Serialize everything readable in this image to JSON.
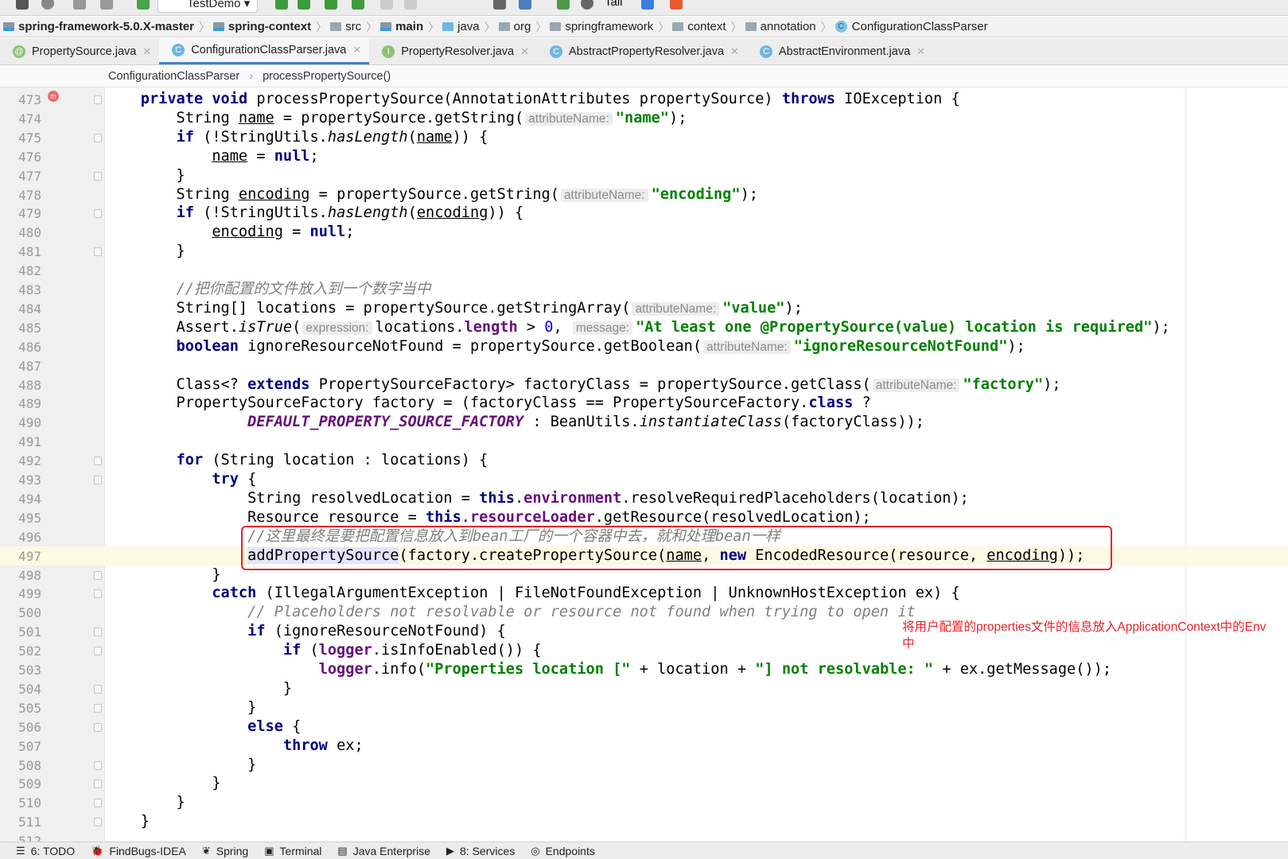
{
  "toolbar": {
    "run_config": "TestDemo",
    "tail_label": "Tail"
  },
  "navbar": {
    "items": [
      {
        "label": "spring-framework-5.0.X-master",
        "bold": true,
        "icon": "module-folder-icon"
      },
      {
        "label": "spring-context",
        "bold": true,
        "icon": "module-folder-icon"
      },
      {
        "label": "src",
        "bold": false,
        "icon": "folder-icon"
      },
      {
        "label": "main",
        "bold": true,
        "icon": "module-folder-icon"
      },
      {
        "label": "java",
        "bold": false,
        "icon": "source-folder-icon"
      },
      {
        "label": "org",
        "bold": false,
        "icon": "folder-icon"
      },
      {
        "label": "springframework",
        "bold": false,
        "icon": "folder-icon"
      },
      {
        "label": "context",
        "bold": false,
        "icon": "folder-icon"
      },
      {
        "label": "annotation",
        "bold": false,
        "icon": "folder-icon"
      },
      {
        "label": "ConfigurationClassParser",
        "bold": false,
        "icon": "class-icon"
      }
    ]
  },
  "tabs": [
    {
      "label": "PropertySource.java",
      "badge": "@",
      "color": "#8dc26f",
      "active": false
    },
    {
      "label": "ConfigurationClassParser.java",
      "badge": "C",
      "color": "#6fb6e0",
      "active": true
    },
    {
      "label": "PropertyResolver.java",
      "badge": "I",
      "color": "#8dc26f",
      "active": false
    },
    {
      "label": "AbstractPropertyResolver.java",
      "badge": "C",
      "color": "#6fb6e0",
      "active": false
    },
    {
      "label": "AbstractEnvironment.java",
      "badge": "C",
      "color": "#6fb6e0",
      "active": false
    }
  ],
  "editor_breadcrumb": {
    "class": "ConfigurationClassParser",
    "method": "processPropertySource()"
  },
  "editor": {
    "current_line": 497,
    "lines": [
      {
        "n": "473",
        "t": [
          {
            "t": "    "
          },
          {
            "t": "private",
            "c": "kw"
          },
          {
            "t": " "
          },
          {
            "t": "void",
            "c": "kw"
          },
          {
            "t": " processPropertySource(AnnotationAttributes propertySource) "
          },
          {
            "t": "throws",
            "c": "kw"
          },
          {
            "t": " IOException {"
          }
        ]
      },
      {
        "n": "474",
        "t": [
          {
            "t": "        String "
          },
          {
            "t": "name",
            "c": "ul"
          },
          {
            "t": " = propertySource.getString("
          },
          {
            "t": "attributeName:",
            "c": "hint"
          },
          {
            "t": "\"name\"",
            "c": "str"
          },
          {
            "t": ");"
          }
        ]
      },
      {
        "n": "475",
        "t": [
          {
            "t": "        "
          },
          {
            "t": "if",
            "c": "kw"
          },
          {
            "t": " (!StringUtils."
          },
          {
            "t": "hasLength",
            "c": "it"
          },
          {
            "t": "("
          },
          {
            "t": "name",
            "c": "ul"
          },
          {
            "t": ")) {"
          }
        ]
      },
      {
        "n": "476",
        "t": [
          {
            "t": "            "
          },
          {
            "t": "name",
            "c": "ul"
          },
          {
            "t": " = "
          },
          {
            "t": "null",
            "c": "kw"
          },
          {
            "t": ";"
          }
        ]
      },
      {
        "n": "477",
        "t": [
          {
            "t": "        }"
          }
        ]
      },
      {
        "n": "478",
        "t": [
          {
            "t": "        String "
          },
          {
            "t": "encoding",
            "c": "ul"
          },
          {
            "t": " = propertySource.getString("
          },
          {
            "t": "attributeName:",
            "c": "hint"
          },
          {
            "t": "\"encoding\"",
            "c": "str"
          },
          {
            "t": ");"
          }
        ]
      },
      {
        "n": "479",
        "t": [
          {
            "t": "        "
          },
          {
            "t": "if",
            "c": "kw"
          },
          {
            "t": " (!StringUtils."
          },
          {
            "t": "hasLength",
            "c": "it"
          },
          {
            "t": "("
          },
          {
            "t": "encoding",
            "c": "ul"
          },
          {
            "t": ")) {"
          }
        ]
      },
      {
        "n": "480",
        "t": [
          {
            "t": "            "
          },
          {
            "t": "encoding",
            "c": "ul"
          },
          {
            "t": " = "
          },
          {
            "t": "null",
            "c": "kw"
          },
          {
            "t": ";"
          }
        ]
      },
      {
        "n": "481",
        "t": [
          {
            "t": "        }"
          }
        ]
      },
      {
        "n": "482",
        "t": []
      },
      {
        "n": "483",
        "t": [
          {
            "t": "        "
          },
          {
            "t": "//把你配置的文件放入到一个数字当中",
            "c": "cm"
          }
        ]
      },
      {
        "n": "484",
        "t": [
          {
            "t": "        String[] locations = propertySource.getStringArray("
          },
          {
            "t": "attributeName:",
            "c": "hint"
          },
          {
            "t": "\"value\"",
            "c": "str"
          },
          {
            "t": ");"
          }
        ]
      },
      {
        "n": "485",
        "t": [
          {
            "t": "        Assert."
          },
          {
            "t": "isTrue",
            "c": "it"
          },
          {
            "t": "("
          },
          {
            "t": "expression:",
            "c": "hint"
          },
          {
            "t": "locations."
          },
          {
            "t": "length",
            "c": "field"
          },
          {
            "t": " > "
          },
          {
            "t": "0",
            "c": "num"
          },
          {
            "t": ", "
          },
          {
            "t": "message:",
            "c": "hint"
          },
          {
            "t": "\"At least one @PropertySource(value) location is required\"",
            "c": "str"
          },
          {
            "t": ");"
          }
        ]
      },
      {
        "n": "486",
        "t": [
          {
            "t": "        "
          },
          {
            "t": "boolean",
            "c": "kw"
          },
          {
            "t": " ignoreResourceNotFound = propertySource.getBoolean("
          },
          {
            "t": "attributeName:",
            "c": "hint"
          },
          {
            "t": "\"ignoreResourceNotFound\"",
            "c": "str"
          },
          {
            "t": ");"
          }
        ]
      },
      {
        "n": "487",
        "t": []
      },
      {
        "n": "488",
        "t": [
          {
            "t": "        Class<? "
          },
          {
            "t": "extends",
            "c": "kw"
          },
          {
            "t": " PropertySourceFactory> factoryClass = propertySource.getClass("
          },
          {
            "t": "attributeName:",
            "c": "hint"
          },
          {
            "t": "\"factory\"",
            "c": "str"
          },
          {
            "t": ");"
          }
        ]
      },
      {
        "n": "489",
        "t": [
          {
            "t": "        PropertySourceFactory factory = (factoryClass == PropertySourceFactory."
          },
          {
            "t": "class",
            "c": "kw"
          },
          {
            "t": " ?"
          }
        ]
      },
      {
        "n": "490",
        "t": [
          {
            "t": "                "
          },
          {
            "t": "DEFAULT_PROPERTY_SOURCE_FACTORY",
            "c": "const"
          },
          {
            "t": " : BeanUtils."
          },
          {
            "t": "instantiateClass",
            "c": "it"
          },
          {
            "t": "(factoryClass));"
          }
        ]
      },
      {
        "n": "491",
        "t": []
      },
      {
        "n": "492",
        "t": [
          {
            "t": "        "
          },
          {
            "t": "for",
            "c": "kw"
          },
          {
            "t": " (String location : locations) {"
          }
        ]
      },
      {
        "n": "493",
        "t": [
          {
            "t": "            "
          },
          {
            "t": "try",
            "c": "kw"
          },
          {
            "t": " {"
          }
        ]
      },
      {
        "n": "494",
        "t": [
          {
            "t": "                String resolvedLocation = "
          },
          {
            "t": "this",
            "c": "kw"
          },
          {
            "t": "."
          },
          {
            "t": "environment",
            "c": "field"
          },
          {
            "t": ".resolveRequiredPlaceholders(location);"
          }
        ]
      },
      {
        "n": "495",
        "t": [
          {
            "t": "                Resource resource = "
          },
          {
            "t": "this",
            "c": "kw"
          },
          {
            "t": "."
          },
          {
            "t": "resourceLoader",
            "c": "field"
          },
          {
            "t": ".getResource(resolvedLocation);"
          }
        ]
      },
      {
        "n": "496",
        "t": [
          {
            "t": "                "
          },
          {
            "t": "//这里最终是要把配置信息放入到bean工厂的一个容器中去，就和处理bean一样",
            "c": "cm"
          }
        ]
      },
      {
        "n": "497",
        "t": [
          {
            "t": "                "
          },
          {
            "t": "addPropertySource",
            "c": "caret"
          },
          {
            "t": "(factory.createPropertySource("
          },
          {
            "t": "name",
            "c": "ul"
          },
          {
            "t": ", "
          },
          {
            "t": "new",
            "c": "kw"
          },
          {
            "t": " EncodedResource(resource, "
          },
          {
            "t": "encoding",
            "c": "ul"
          },
          {
            "t": "));"
          }
        ]
      },
      {
        "n": "498",
        "t": [
          {
            "t": "            }"
          }
        ]
      },
      {
        "n": "499",
        "t": [
          {
            "t": "            "
          },
          {
            "t": "catch",
            "c": "kw"
          },
          {
            "t": " (IllegalArgumentException | FileNotFoundException | UnknownHostException ex) {"
          }
        ]
      },
      {
        "n": "500",
        "t": [
          {
            "t": "                "
          },
          {
            "t": "// Placeholders not resolvable or resource not found when trying to open it",
            "c": "cm"
          }
        ]
      },
      {
        "n": "501",
        "t": [
          {
            "t": "                "
          },
          {
            "t": "if",
            "c": "kw"
          },
          {
            "t": " (ignoreResourceNotFound) {"
          }
        ]
      },
      {
        "n": "502",
        "t": [
          {
            "t": "                    "
          },
          {
            "t": "if",
            "c": "kw"
          },
          {
            "t": " ("
          },
          {
            "t": "logger",
            "c": "field"
          },
          {
            "t": ".isInfoEnabled()) {"
          }
        ]
      },
      {
        "n": "503",
        "t": [
          {
            "t": "                        "
          },
          {
            "t": "logger",
            "c": "field"
          },
          {
            "t": ".info("
          },
          {
            "t": "\"Properties location [\"",
            "c": "str"
          },
          {
            "t": " + location + "
          },
          {
            "t": "\"] not resolvable: \"",
            "c": "str"
          },
          {
            "t": " + ex.getMessage());"
          }
        ]
      },
      {
        "n": "504",
        "t": [
          {
            "t": "                    }"
          }
        ]
      },
      {
        "n": "505",
        "t": [
          {
            "t": "                }"
          }
        ]
      },
      {
        "n": "506",
        "t": [
          {
            "t": "                "
          },
          {
            "t": "else",
            "c": "kw"
          },
          {
            "t": " {"
          }
        ]
      },
      {
        "n": "507",
        "t": [
          {
            "t": "                    "
          },
          {
            "t": "throw",
            "c": "kw"
          },
          {
            "t": " ex;"
          }
        ]
      },
      {
        "n": "508",
        "t": [
          {
            "t": "                }"
          }
        ]
      },
      {
        "n": "509",
        "t": [
          {
            "t": "            }"
          }
        ]
      },
      {
        "n": "510",
        "t": [
          {
            "t": "        }"
          }
        ]
      },
      {
        "n": "511",
        "t": [
          {
            "t": "    }"
          }
        ]
      },
      {
        "n": "512",
        "t": []
      }
    ]
  },
  "annotation": {
    "text": "将用户配置的properties文件的信息放入ApplicationContext中的Env中",
    "color": "#e8242b"
  },
  "bottom_tools": [
    {
      "label": "6: TODO",
      "icon": "list-icon"
    },
    {
      "label": "FindBugs-IDEA",
      "icon": "bug-icon"
    },
    {
      "label": "Spring",
      "icon": "spring-leaf-icon"
    },
    {
      "label": "Terminal",
      "icon": "terminal-icon"
    },
    {
      "label": "Java Enterprise",
      "icon": "java-enterprise-icon"
    },
    {
      "label": "8: Services",
      "icon": "services-icon"
    },
    {
      "label": "Endpoints",
      "icon": "endpoints-icon"
    }
  ]
}
